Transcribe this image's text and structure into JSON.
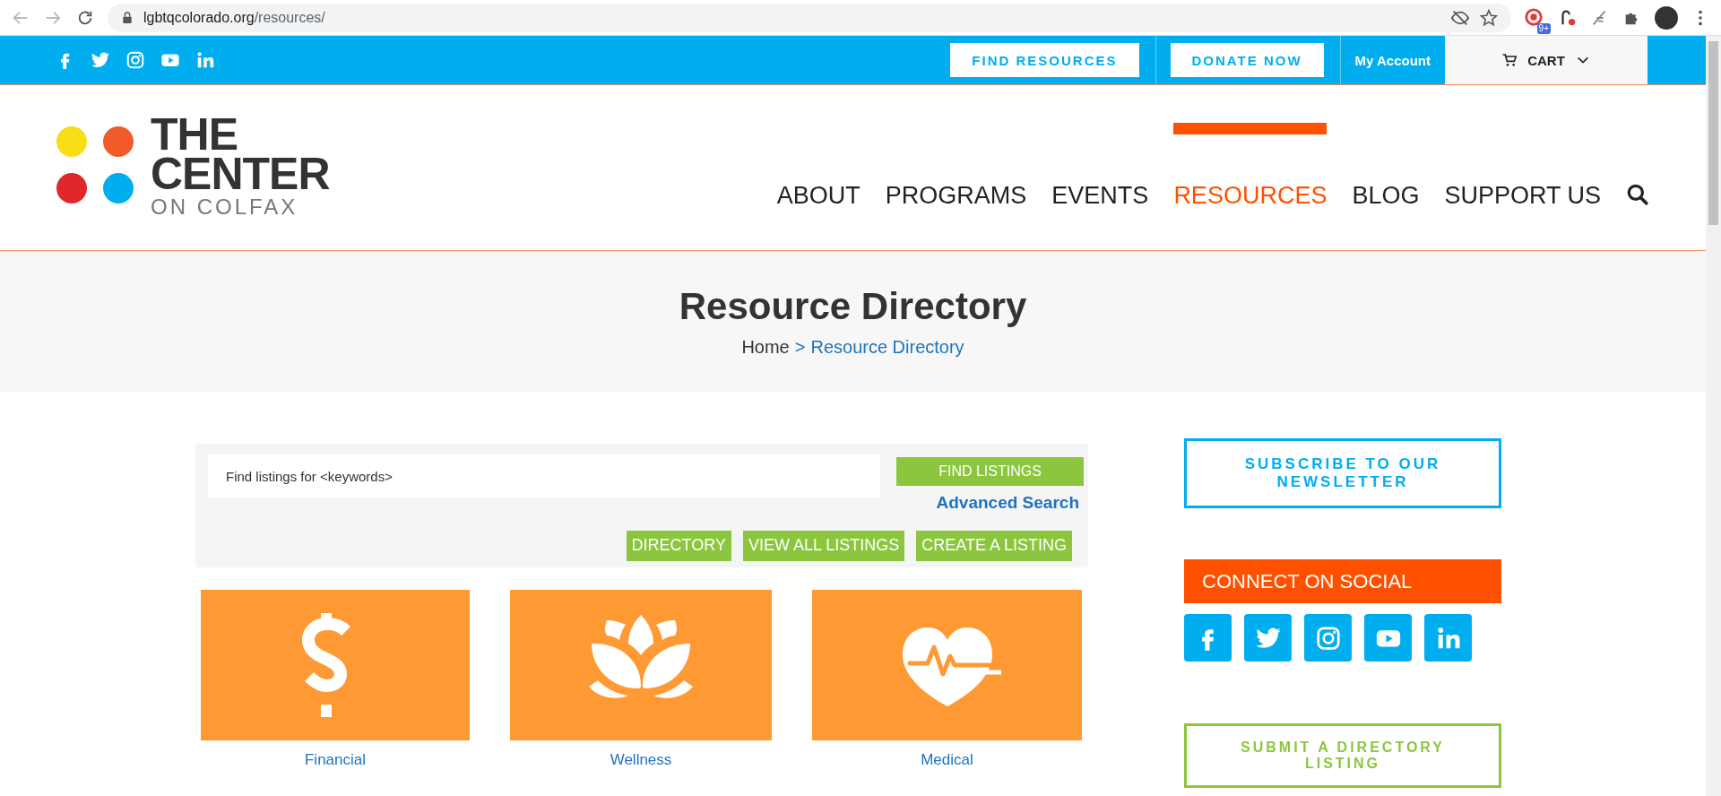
{
  "browser": {
    "url_host": "lgbtqcolorado.org",
    "url_path": "/resources/",
    "extension_badge": "9+"
  },
  "topbar": {
    "social": [
      {
        "kind": "facebook"
      },
      {
        "kind": "twitter"
      },
      {
        "kind": "instagram"
      },
      {
        "kind": "youtube"
      },
      {
        "kind": "linkedin"
      }
    ],
    "find_resources": "FIND RESOURCES",
    "donate": "DONATE NOW",
    "account": "My Account",
    "cart": "CART"
  },
  "logo": {
    "line_1": "THE",
    "line_2": "CENTER",
    "line_3": "ON COLFAX"
  },
  "nav": [
    {
      "label": "ABOUT",
      "selected": false
    },
    {
      "label": "PROGRAMS",
      "selected": false
    },
    {
      "label": "EVENTS",
      "selected": false
    },
    {
      "label": "RESOURCES",
      "selected": true
    },
    {
      "label": "BLOG",
      "selected": false
    },
    {
      "label": "SUPPORT US",
      "selected": false
    }
  ],
  "page_title": "Resource Directory",
  "breadcrumb": {
    "home": "Home",
    "separator": ">",
    "current": "Resource Directory"
  },
  "search": {
    "placeholder": "Find listings for <keywords>",
    "find_button": "FIND LISTINGS",
    "advanced": "Advanced Search",
    "buttons": [
      "DIRECTORY",
      "VIEW ALL LISTINGS",
      "CREATE A LISTING"
    ]
  },
  "categories": [
    {
      "label": "Financial",
      "kind": "dollar"
    },
    {
      "label": "Wellness",
      "kind": "lotus"
    },
    {
      "label": "Medical",
      "kind": "heart"
    }
  ],
  "sidebar": {
    "subscribe": "SUBSCRIBE TO OUR NEWSLETTER",
    "connect_title": "CONNECT ON SOCIAL",
    "social": [
      {
        "kind": "facebook"
      },
      {
        "kind": "twitter"
      },
      {
        "kind": "instagram"
      },
      {
        "kind": "youtube"
      },
      {
        "kind": "linkedin"
      }
    ],
    "submit": "SUBMIT A DIRECTORY LISTING"
  }
}
